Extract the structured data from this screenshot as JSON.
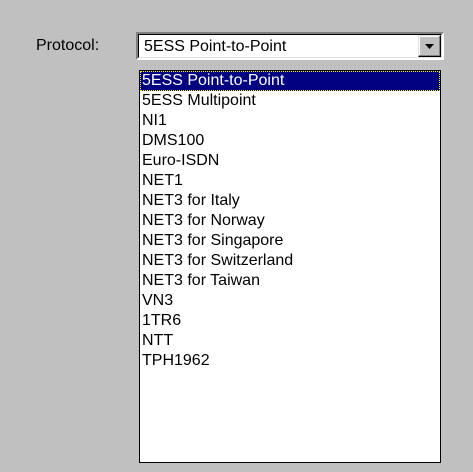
{
  "protocol": {
    "label": "Protocol:",
    "selected_value": "5ESS Point-to-Point",
    "dropdown_icon": "chevron-down-icon",
    "options": [
      "5ESS Point-to-Point",
      "5ESS Multipoint",
      "NI1",
      "DMS100",
      "Euro-ISDN",
      "NET1",
      "NET3 for Italy",
      "NET3 for Norway",
      "NET3 for Singapore",
      "NET3 for Switzerland",
      "NET3 for Taiwan",
      "VN3",
      "1TR6",
      "NTT",
      "TPH1962"
    ],
    "highlighted_index": 0
  },
  "colors": {
    "background": "#c0c0c0",
    "highlight": "#000080",
    "highlight_text": "#ffffff"
  }
}
